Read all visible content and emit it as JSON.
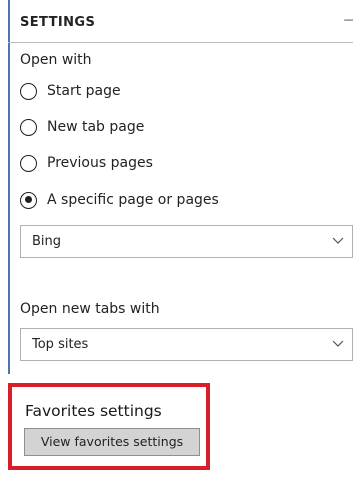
{
  "header": {
    "title": "SETTINGS",
    "pin_glyph": "⊣"
  },
  "open_with": {
    "label": "Open with",
    "options": [
      {
        "label": "Start page",
        "checked": false
      },
      {
        "label": "New tab page",
        "checked": false
      },
      {
        "label": "Previous pages",
        "checked": false
      },
      {
        "label": "A specific page or pages",
        "checked": true
      }
    ],
    "page_select": {
      "value": "Bing"
    }
  },
  "new_tabs": {
    "label": "Open new tabs with",
    "select": {
      "value": "Top sites"
    }
  },
  "favorites": {
    "title": "Favorites settings",
    "button_label": "View favorites settings",
    "highlight_color": "#d71f2a"
  },
  "colors": {
    "accent_border": "#4a74b5",
    "button_bg": "#d3d3d3"
  }
}
